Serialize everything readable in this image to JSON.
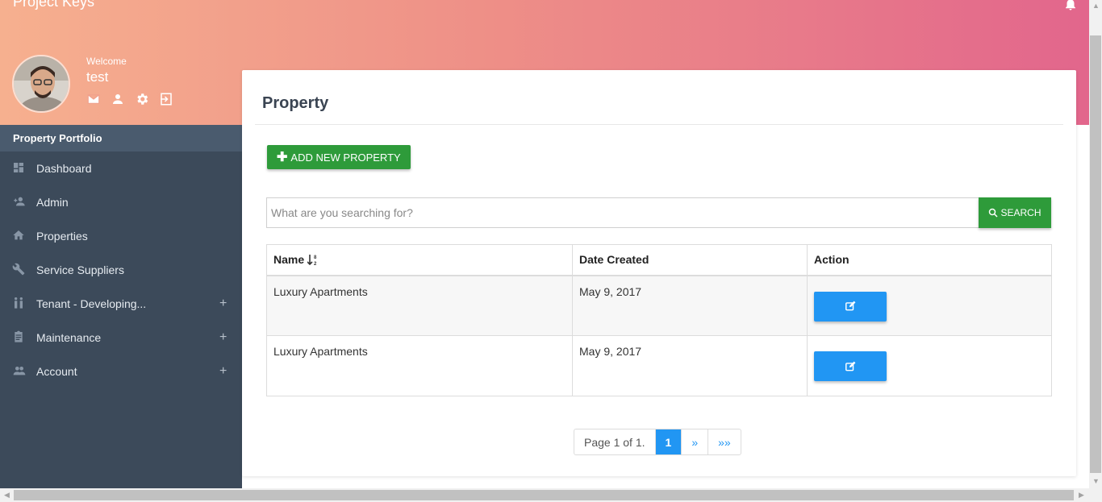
{
  "app": {
    "title": "Project Keys"
  },
  "profile": {
    "welcome": "Welcome",
    "username": "test"
  },
  "sidebar": {
    "heading": "Property Portfolio",
    "items": [
      {
        "label": "Dashboard",
        "icon": "dashboard-icon",
        "expandable": false
      },
      {
        "label": "Admin",
        "icon": "add-user-icon",
        "expandable": false
      },
      {
        "label": "Properties",
        "icon": "home-icon",
        "expandable": false
      },
      {
        "label": "Service Suppliers",
        "icon": "wrench-icon",
        "expandable": false
      },
      {
        "label": "Tenant - Developing...",
        "icon": "people-icon",
        "expandable": true,
        "toggle": "+"
      },
      {
        "label": "Maintenance",
        "icon": "clipboard-icon",
        "expandable": true,
        "toggle": "+"
      },
      {
        "label": "Account",
        "icon": "group-icon",
        "expandable": true,
        "toggle": "+"
      }
    ]
  },
  "main": {
    "title": "Property",
    "add_button": "ADD NEW PROPERTY",
    "search": {
      "placeholder": "What are you searching for?",
      "button": "SEARCH"
    },
    "table": {
      "headers": [
        "Name",
        "Date Created",
        "Action"
      ],
      "rows": [
        {
          "name": "Luxury Apartments",
          "date": "May 9, 2017"
        },
        {
          "name": "Luxury Apartments",
          "date": "May 9, 2017"
        }
      ]
    },
    "pagination": {
      "info": "Page 1 of 1.",
      "current": "1",
      "next": "»",
      "last": "»»"
    }
  },
  "colors": {
    "accent_green": "#2e9b3a",
    "accent_blue": "#2196f3",
    "sidebar": "#3c4a5a"
  }
}
